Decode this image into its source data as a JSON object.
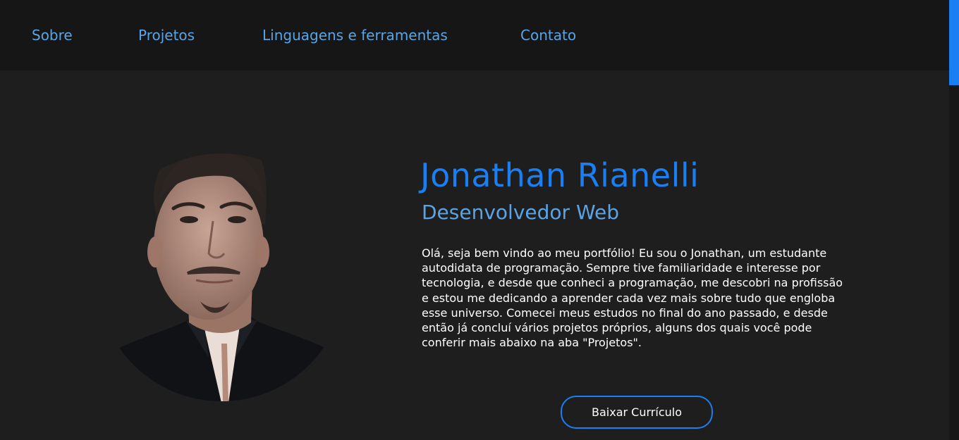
{
  "nav": {
    "items": [
      {
        "label": "Sobre"
      },
      {
        "label": "Projetos"
      },
      {
        "label": "Linguagens e ferramentas"
      },
      {
        "label": "Contato"
      }
    ]
  },
  "profile": {
    "name": "Jonathan Rianelli",
    "role": "Desenvolvedor Web",
    "bio": "Olá, seja bem vindo ao meu portfólio! Eu sou o Jonathan, um estudante autodidata de programação. Sempre tive familiaridade e interesse por tecnologia, e desde que conheci a programação, me descobri na profissão e estou me dedicando a aprender cada vez mais sobre tudo que engloba esse universo. Comecei meus estudos no final do ano passado, e desde então já concluí vários projetos próprios, alguns dos quais você pode conferir mais abaixo na aba \"Projetos\".",
    "cv_button": "Baixar Currículo"
  },
  "colors": {
    "background": "#1e1e1f",
    "navbar": "#161616",
    "accent": "#1a7ff2",
    "nav_link": "#5aa4e6",
    "text": "#ffffff"
  }
}
